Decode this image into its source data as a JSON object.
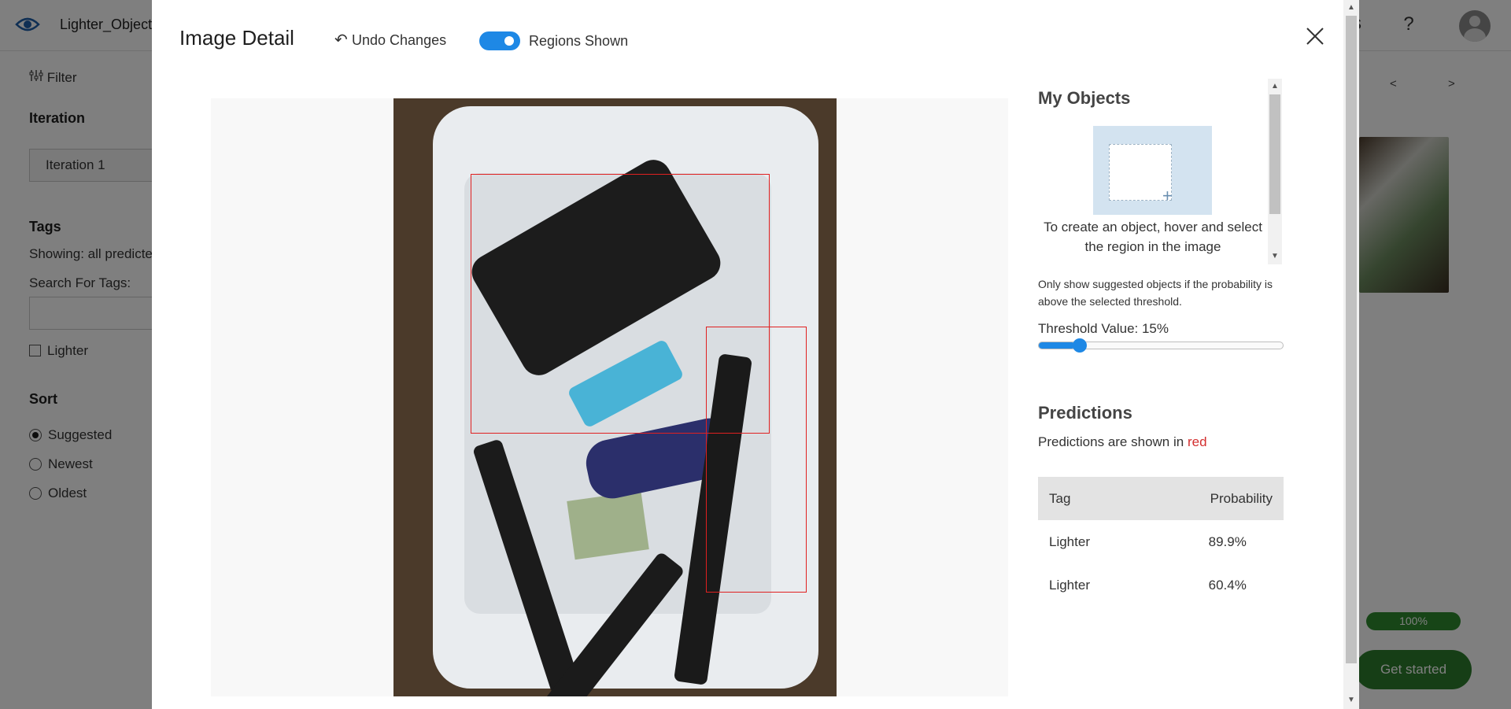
{
  "background": {
    "project_title": "Lighter_Object",
    "partial_header_text": "s",
    "help_label": "?",
    "filter_label": "Filter",
    "iteration_title": "Iteration",
    "iteration_value": "Iteration 1",
    "tags_title": "Tags",
    "tags_showing": "Showing: all predicte",
    "search_tags_label": "Search For Tags:",
    "tag_checkbox_label": "Lighter",
    "sort_title": "Sort",
    "sort_options": [
      "Suggested",
      "Newest",
      "Oldest"
    ],
    "sort_selected": "Suggested",
    "prev_arrow": "<",
    "next_arrow": ">",
    "progress_label": "100%",
    "progress_value": 1.0,
    "get_started_label": "Get started"
  },
  "modal": {
    "title": "Image Detail",
    "undo_label": "Undo Changes",
    "regions_label": "Regions Shown",
    "regions_on": true,
    "my_objects_title": "My Objects",
    "create_hint": "To create an object, hover and select the region in the image",
    "threshold_note": "Only show suggested objects if the probability is above the selected threshold.",
    "threshold_label": "Threshold Value: 15%",
    "threshold_value": 0.15,
    "predictions_title": "Predictions",
    "predictions_note_prefix": "Predictions are shown in",
    "predictions_note_color_word": "red",
    "table_headers": [
      "Tag",
      "Probability"
    ],
    "predictions": [
      {
        "tag": "Lighter",
        "probability": "89.9%"
      },
      {
        "tag": "Lighter",
        "probability": "60.4%"
      }
    ]
  },
  "colors": {
    "accent": "#1e88e5",
    "prediction_box": "#e02020",
    "success": "#2d7d2d"
  },
  "icons": [
    "eye-logo-icon",
    "help-icon",
    "avatar-icon",
    "filter-icon",
    "undo-icon",
    "close-icon",
    "plus-icon"
  ]
}
